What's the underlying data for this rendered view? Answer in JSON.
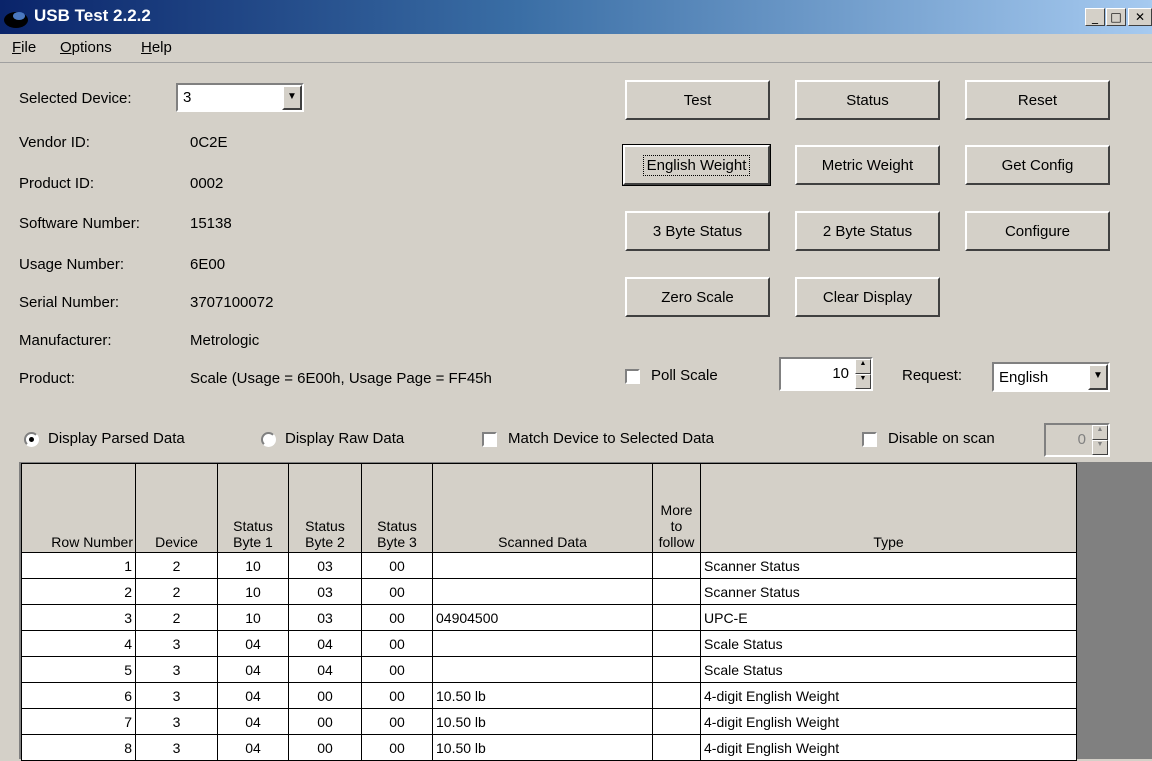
{
  "window": {
    "title": "USB Test 2.2.2"
  },
  "menu": {
    "file": "File",
    "options": "Options",
    "help": "Help"
  },
  "device": {
    "selected_label": "Selected Device:",
    "selected_value": "3",
    "fields": [
      {
        "label": "Vendor ID:",
        "value": "0C2E"
      },
      {
        "label": "Product ID:",
        "value": "0002"
      },
      {
        "label": "Software Number:",
        "value": "15138"
      },
      {
        "label": "Usage Number:",
        "value": "6E00"
      },
      {
        "label": "Serial Number:",
        "value": "3707100072"
      },
      {
        "label": "Manufacturer:",
        "value": "Metrologic"
      },
      {
        "label": "Product:",
        "value": "Scale (Usage = 6E00h, Usage Page = FF45h"
      }
    ]
  },
  "buttons": {
    "test": "Test",
    "status": "Status",
    "reset": "Reset",
    "english_weight": "English Weight",
    "metric_weight": "Metric Weight",
    "get_config": "Get Config",
    "three_byte_status": "3 Byte Status",
    "two_byte_status": "2 Byte Status",
    "configure": "Configure",
    "zero_scale": "Zero Scale",
    "clear_display": "Clear Display"
  },
  "poll": {
    "label": "Poll Scale",
    "checked": false,
    "interval": "10"
  },
  "request": {
    "label": "Request:",
    "value": "English"
  },
  "options": {
    "parsed": "Display Parsed Data",
    "raw": "Display Raw Data",
    "match": "Match Device to Selected Data",
    "disable": "Disable on scan",
    "disable_value": "0"
  },
  "table": {
    "headers": [
      "Row Number",
      "Device",
      "Status Byte 1",
      "Status Byte 2",
      "Status Byte 3",
      "Scanned Data",
      "More to follow",
      "Type"
    ],
    "rows": [
      [
        "1",
        "2",
        "10",
        "03",
        "00",
        "",
        "",
        "Scanner Status"
      ],
      [
        "2",
        "2",
        "10",
        "03",
        "00",
        "",
        "",
        "Scanner Status"
      ],
      [
        "3",
        "2",
        "10",
        "03",
        "00",
        "04904500",
        "",
        "UPC-E"
      ],
      [
        "4",
        "3",
        "04",
        "04",
        "00",
        "",
        "",
        "Scale Status"
      ],
      [
        "5",
        "3",
        "04",
        "04",
        "00",
        "",
        "",
        "Scale Status"
      ],
      [
        "6",
        "3",
        "04",
        "00",
        "00",
        "10.50 lb",
        "",
        "4-digit English Weight"
      ],
      [
        "7",
        "3",
        "04",
        "00",
        "00",
        "10.50 lb",
        "",
        "4-digit English Weight"
      ],
      [
        "8",
        "3",
        "04",
        "00",
        "00",
        "10.50 lb",
        "",
        "4-digit English Weight"
      ]
    ]
  }
}
